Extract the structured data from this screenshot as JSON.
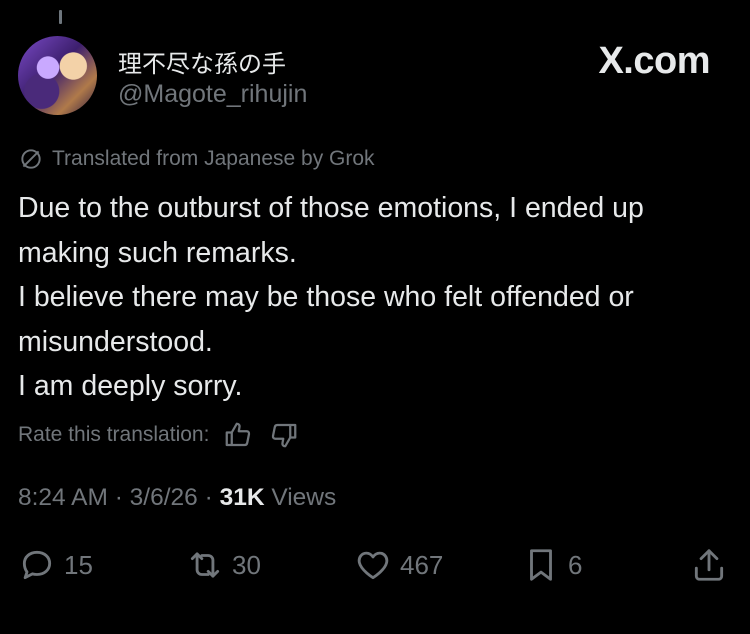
{
  "author": {
    "display_name": "理不尽な孫の手",
    "handle": "@Magote_rihujin"
  },
  "brand": "X.com",
  "translation": {
    "notice": "Translated from Japanese by Grok",
    "rate_label": "Rate this translation:"
  },
  "tweet": {
    "lines": [
      "Due to the outburst of those emotions, I ended up making such remarks.",
      "I believe there may be those who felt offended or misunderstood.",
      "I am deeply sorry."
    ]
  },
  "meta": {
    "time": "8:24 AM",
    "date": "3/6/26",
    "views_count": "31K",
    "views_label": "Views"
  },
  "actions": {
    "replies": "15",
    "reposts": "30",
    "likes": "467",
    "bookmarks": "6"
  },
  "colors": {
    "background": "#000000",
    "text": "#e7e9ea",
    "secondary": "#71767b"
  }
}
